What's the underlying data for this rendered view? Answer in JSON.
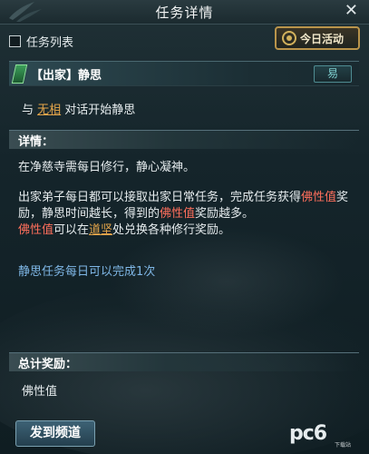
{
  "window": {
    "title": "任务详情",
    "close_glyph": "✕"
  },
  "filter": {
    "checkbox_label": "任务列表",
    "checked": false
  },
  "today_button": {
    "label": "今日活动",
    "icon": "gold-coin-icon"
  },
  "quest": {
    "title": "【出家】静思",
    "difficulty": "易",
    "intro": {
      "prefix": "与 ",
      "npc": "无相",
      "suffix": " 对话开始静思"
    }
  },
  "details": {
    "header": "详情：",
    "p1": "在净慈寺需每日修行，静心凝神。",
    "p2": {
      "a": "出家弟子每日都可以接取出家日常任务，完成任务获得",
      "b": "佛性值",
      "c": "奖励，静思时间越长，得到的",
      "d": "佛性值",
      "e": "奖励越多。"
    },
    "p3": {
      "a": "佛性值",
      "b": "可以在",
      "c": "道坚",
      "d": "处兑换各种修行奖励。"
    },
    "note": "静思任务每日可以完成1次"
  },
  "rewards": {
    "header": "总计奖励：",
    "item": "佛性值"
  },
  "send_button": {
    "label": "发到频道"
  },
  "watermark": {
    "text": "pc6",
    "sub": "下载站"
  },
  "colors": {
    "highlight_red": "#ff6f5c",
    "highlight_orange": "#e6a64a",
    "note_blue": "#7fb7e6",
    "gold_border": "#b9944b"
  }
}
